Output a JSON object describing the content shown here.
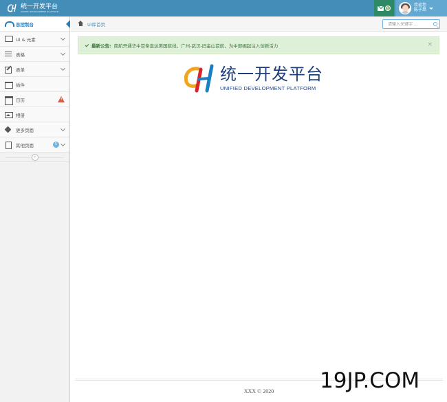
{
  "navbar": {
    "brand_title": "统一开发平台",
    "brand_subtitle": "UNIFIED DEVELOPMENT PLATFORM",
    "mail_badge": "5",
    "user_greeting": "欢迎您",
    "user_name": "陈子昂",
    "colors": {
      "navbar": "#438eb9",
      "mail_bg": "#2e8965",
      "user_bg": "#62a8d1"
    }
  },
  "sidebar": {
    "items": [
      {
        "label": "总控制台",
        "icon": "dashboard-icon",
        "active": true
      },
      {
        "label": "UI & 元素",
        "icon": "monitor-icon",
        "has_submenu": true
      },
      {
        "label": "表格",
        "icon": "list-icon",
        "has_submenu": true
      },
      {
        "label": "表单",
        "icon": "edit-icon",
        "has_submenu": true
      },
      {
        "label": "插件",
        "icon": "plugin-icon"
      },
      {
        "label": "日历",
        "icon": "calendar-icon",
        "alert": "!"
      },
      {
        "label": "相册",
        "icon": "picture-icon"
      },
      {
        "label": "更多页面",
        "icon": "tag-icon",
        "has_submenu": true
      },
      {
        "label": "其他页面",
        "icon": "file-icon",
        "has_submenu": true,
        "badge": "5"
      }
    ],
    "collapse_symbol": "«"
  },
  "breadcrumbs": {
    "home_label": "UI库首页"
  },
  "search": {
    "placeholder": "请输入关键字 ..."
  },
  "alert": {
    "title": "最新公告:",
    "message": "南航开通华中首条直达美国航线，广州-武汉-旧金山首航，为中部崛起注入创新活力",
    "close_symbol": "×"
  },
  "logo": {
    "title_cn": "统一开发平台",
    "title_en": "UNIFIED DEVELOPMENT PLATFORM"
  },
  "footer": {
    "text": "XXX © 2020"
  },
  "watermark": {
    "text": "19JP.COM"
  }
}
